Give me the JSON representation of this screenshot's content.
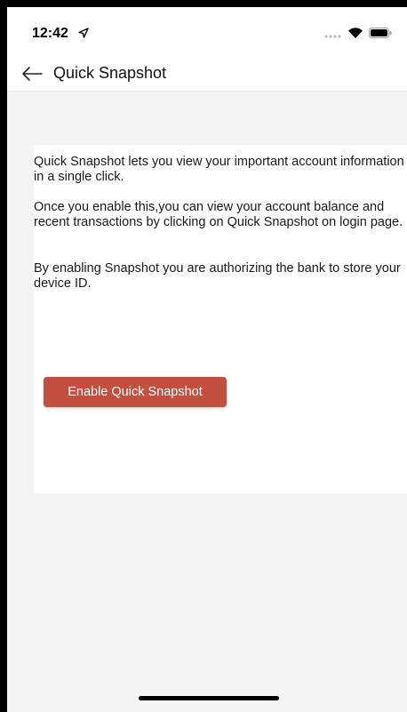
{
  "status_bar": {
    "time": "12:42",
    "icons": [
      "location-arrow-icon",
      "signal-dots-icon",
      "wifi-icon",
      "battery-icon"
    ]
  },
  "header": {
    "title": "Quick Snapshot",
    "back_icon": "arrow-left-icon"
  },
  "content": {
    "paragraphs": [
      "Quick Snapshot lets you view your important account information in a single click.",
      "Once you enable this,you can view your account balance and recent transactions by clicking on Quick Snapshot on login page.",
      "By enabling Snapshot you are authorizing the bank to store your device ID."
    ],
    "enable_button_label": "Enable Quick Snapshot"
  },
  "colors": {
    "accent": "#c24f3f",
    "background": "#f4f4f4",
    "card": "#ffffff"
  }
}
